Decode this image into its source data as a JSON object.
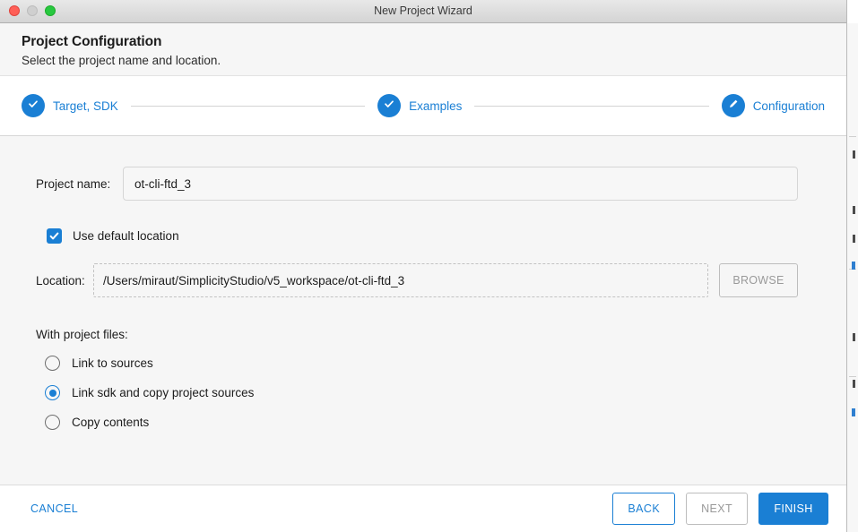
{
  "window": {
    "title": "New Project Wizard",
    "controls": {
      "close": "close-button",
      "minimize": "minimize-button",
      "zoom": "zoom-button"
    }
  },
  "header": {
    "title": "Project Configuration",
    "subtitle": "Select the project name and location."
  },
  "stepper": {
    "steps": [
      {
        "label": "Target, SDK",
        "icon": "check-icon",
        "state": "complete"
      },
      {
        "label": "Examples",
        "icon": "check-icon",
        "state": "complete"
      },
      {
        "label": "Configuration",
        "icon": "pencil-icon",
        "state": "current"
      }
    ]
  },
  "form": {
    "project_name": {
      "label": "Project name:",
      "value": "ot-cli-ftd_3",
      "placeholder": ""
    },
    "use_default_location": {
      "label": "Use default location",
      "checked": true
    },
    "location": {
      "label": "Location:",
      "value": "/Users/miraut/SimplicityStudio/v5_workspace/ot-cli-ftd_3",
      "placeholder": "",
      "browse_label": "BROWSE",
      "browse_disabled": true
    },
    "with_project_files": {
      "label": "With project files:",
      "options": [
        {
          "label": "Link to sources",
          "selected": false
        },
        {
          "label": "Link sdk and copy project sources",
          "selected": true
        },
        {
          "label": "Copy contents",
          "selected": false
        }
      ]
    }
  },
  "footer": {
    "cancel_label": "CANCEL",
    "back_label": "BACK",
    "next_label": "NEXT",
    "finish_label": "FINISH",
    "next_disabled": true
  },
  "colors": {
    "accent": "#1a7fd4",
    "header_bg": "#f6f6f6",
    "content_bg": "#f6f6f6",
    "disabled_text": "#9a9a9a"
  }
}
